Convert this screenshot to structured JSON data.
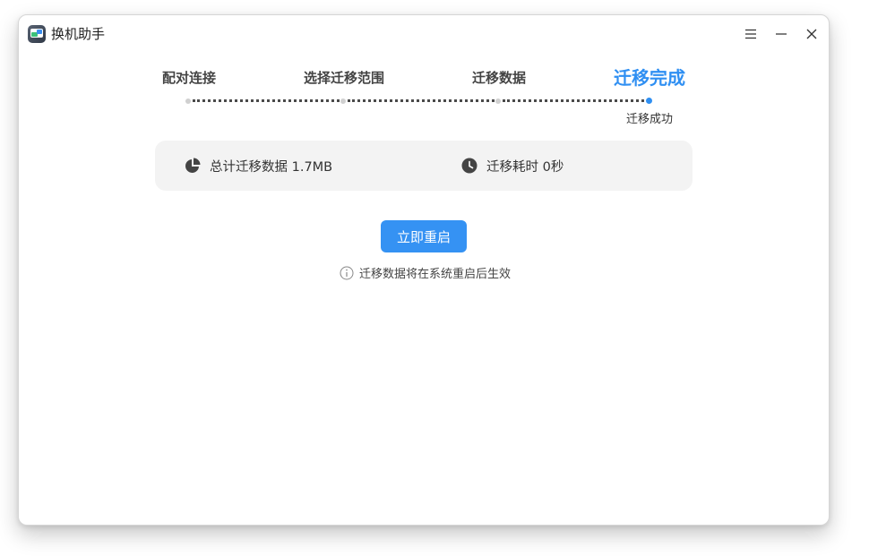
{
  "window": {
    "title": "换机助手"
  },
  "titlebar": {
    "icons": [
      "menu-icon",
      "minimize-icon",
      "close-icon"
    ]
  },
  "steps": {
    "items": [
      {
        "label": "配对连接",
        "state": "done"
      },
      {
        "label": "选择迁移范围",
        "state": "done"
      },
      {
        "label": "迁移数据",
        "state": "done"
      },
      {
        "label": "迁移完成",
        "state": "active"
      }
    ],
    "status": "迁移成功"
  },
  "summary": {
    "total_label": "总计迁移数据 1.7MB",
    "time_label": "迁移耗时 0秒",
    "total_icon": "pie-chart-icon",
    "time_icon": "clock-icon"
  },
  "actions": {
    "restart_label": "立即重启",
    "hint": "迁移数据将在系统重启后生效",
    "hint_icon": "info-icon"
  },
  "colors": {
    "accent": "#3592f3",
    "card_bg": "#f3f3f3"
  }
}
